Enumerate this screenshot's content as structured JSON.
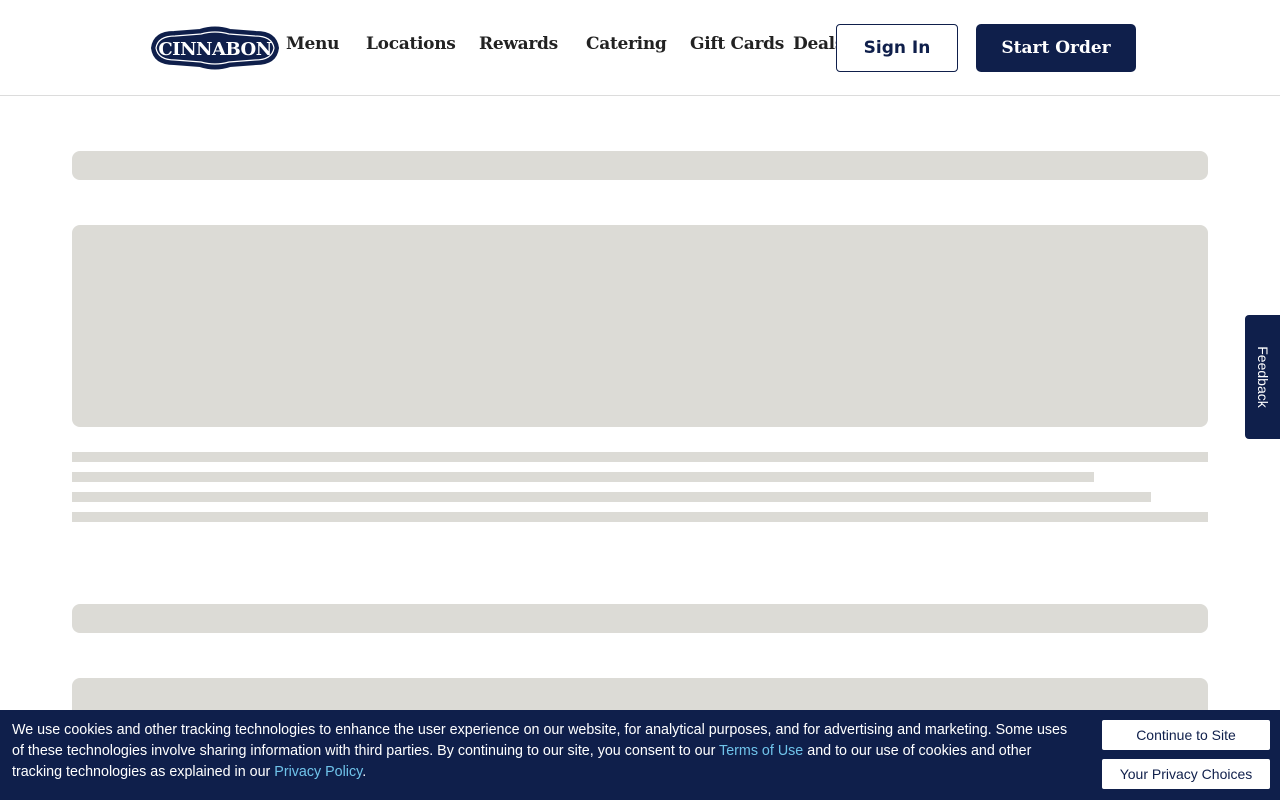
{
  "brand": {
    "logo_text": "CINNABON",
    "primary_color": "#0f1f4b"
  },
  "nav": {
    "items": [
      {
        "label": "Menu"
      },
      {
        "label": "Locations"
      },
      {
        "label": "Rewards"
      },
      {
        "label": "Catering"
      },
      {
        "label": "Gift Cards"
      },
      {
        "label": "Deals"
      }
    ],
    "sign_in_label": "Sign In",
    "start_order_label": "Start Order"
  },
  "feedback": {
    "label": "Feedback"
  },
  "cookie_banner": {
    "text_1": "We use cookies and other tracking technologies to enhance the user experience on our website, for analytical purposes, and for advertising and marketing. Some uses of these technologies involve sharing information with third parties. By continuing to our site, you consent to our ",
    "terms_link": "Terms of Use",
    "text_2": " and to our use of cookies and other tracking technologies as explained in our ",
    "privacy_link": "Privacy Policy",
    "text_3": ".",
    "continue_label": "Continue to Site",
    "privacy_choices_label": "Your Privacy Choices",
    "link_color": "#6fc3ea"
  },
  "skeleton_color": "#dcdbd6"
}
